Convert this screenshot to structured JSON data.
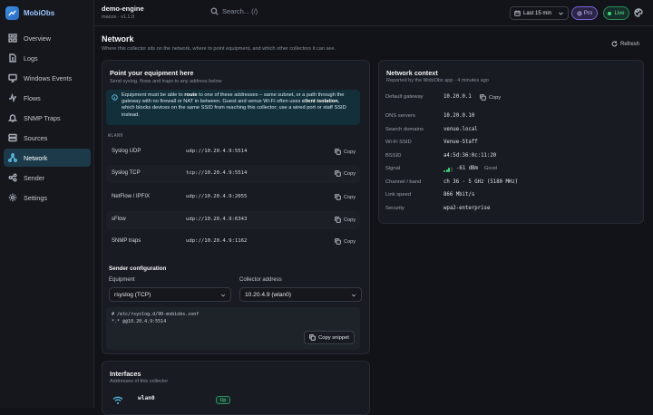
{
  "app": {
    "name": "MobiObs"
  },
  "sidebar": {
    "items": [
      {
        "label": "Overview",
        "icon": "grid-icon"
      },
      {
        "label": "Logs",
        "icon": "file-icon"
      },
      {
        "label": "Windows Events",
        "icon": "monitor-icon"
      },
      {
        "label": "Flows",
        "icon": "activity-icon"
      },
      {
        "label": "SNMP Traps",
        "icon": "bell-icon"
      },
      {
        "label": "Sources",
        "icon": "server-icon"
      },
      {
        "label": "Network",
        "icon": "network-icon",
        "active": true
      },
      {
        "label": "Sender",
        "icon": "send-icon"
      },
      {
        "label": "Settings",
        "icon": "gear-icon"
      }
    ]
  },
  "topbar": {
    "instance_name": "demo-engine",
    "instance_version": "macos · v1.1.0",
    "search_placeholder": "Search... (/)",
    "time_range": "Last 15 min",
    "pro_label": "Pro",
    "live_label": "Live"
  },
  "page": {
    "title": "Network",
    "subtitle": "Where this collector sits on the network, where to point equipment, and which other collectors it can see.",
    "refresh_label": "Refresh"
  },
  "point_card": {
    "title": "Point your equipment here",
    "subtitle": "Send syslog, flows and traps to any address below",
    "info_1": "Equipment must be able to ",
    "info_b1": "route",
    "info_2": " to one of these addresses – same subnet, or a path through the gateway with no firewall or NAT in between. Guest and venue Wi-Fi often uses ",
    "info_b2": "client isolation",
    "info_3": ", which blocks devices on the same SSID from reaching this collector; use a wired port or staff SSID instead.",
    "wlan_label": "WLAN0",
    "copy_label": "Copy",
    "endpoints": [
      {
        "label": "Syslog UDP",
        "address": "udp://10.20.4.9:5514"
      },
      {
        "label": "Syslog TCP",
        "address": "tcp://10.20.4.9:5514"
      },
      {
        "label": "NetFlow / IPFIX",
        "address": "udp://10.20.4.9:2055"
      },
      {
        "label": "sFlow",
        "address": "udp://10.20.4.9:6343"
      },
      {
        "label": "SNMP traps",
        "address": "udp://10.20.4.9:1162"
      }
    ],
    "sender": {
      "title": "Sender configuration",
      "equipment_label": "Equipment",
      "equipment_value": "rsyslog (TCP)",
      "collector_label": "Collector address",
      "collector_value": "10.20.4.9 (wlan0)",
      "snippet_line1": "# /etc/rsyslog.d/90-mobiobs.conf",
      "snippet_line2": "*.* @@10.20.4.9:5514",
      "copy_snippet_label": "Copy snippet"
    }
  },
  "interfaces_card": {
    "title": "Interfaces",
    "subtitle": "Addresses of this collector",
    "items": [
      {
        "name": "wlan0",
        "status": "Up"
      }
    ]
  },
  "context_card": {
    "title": "Network context",
    "subtitle": "Reported by the MobiObs app · 4 minutes ago",
    "copy_label": "Copy",
    "signal_quality": "Good",
    "signal_level_bars": 3,
    "signal_max_bars": 4,
    "rows": [
      {
        "label": "Default gateway",
        "value": "10.20.0.1"
      },
      {
        "label": "DNS servers",
        "value": "10.20.0.10"
      },
      {
        "label": "Search domains",
        "value": "venue.local"
      },
      {
        "label": "Wi-Fi SSID",
        "value": "Venue-Staff"
      },
      {
        "label": "BSSID",
        "value": "a4:5d:36:0c:11:20"
      },
      {
        "label": "Signal",
        "value": "-61 dBm"
      },
      {
        "label": "Channel / band",
        "value": "ch 36 · 5 GHz (5180 MHz)"
      },
      {
        "label": "Link speed",
        "value": "866 Mbit/s"
      },
      {
        "label": "Security",
        "value": "wpa2-enterprise"
      }
    ]
  },
  "colors": {
    "accent": "#5fc6ee",
    "active_bg": "#1c3a4a",
    "live": "#3fd67c",
    "pro": "#7a63d8"
  }
}
